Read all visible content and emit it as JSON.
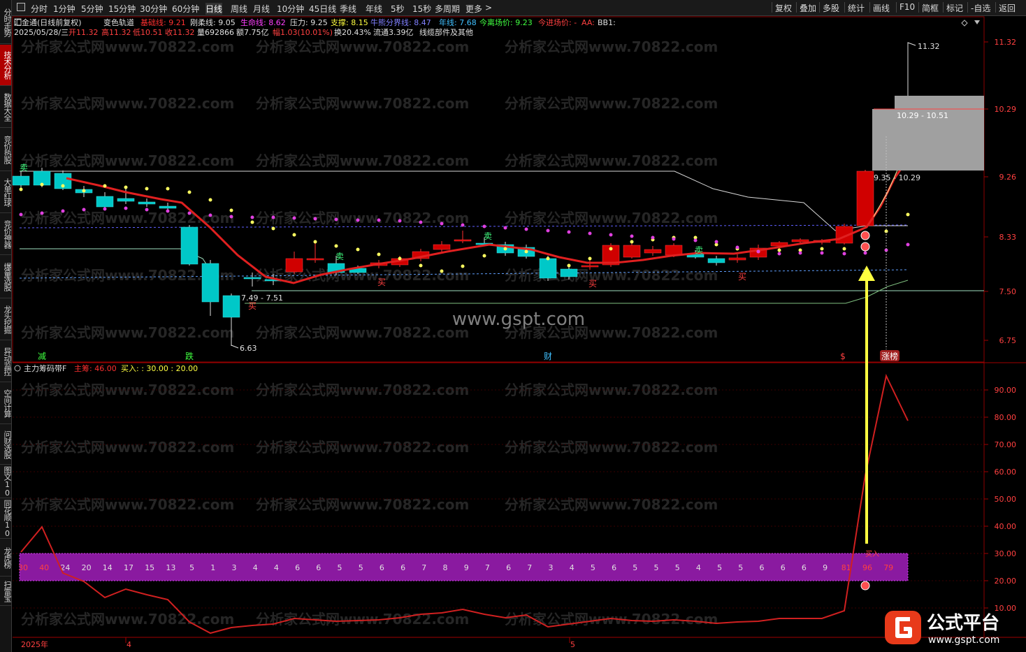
{
  "toolbar": {
    "periods": [
      "分时",
      "1分钟",
      "5分钟",
      "15分钟",
      "30分钟",
      "60分钟",
      "日线",
      "周线",
      "月线",
      "10分钟",
      "45日线",
      "季线",
      "年线",
      "5秒",
      "15秒",
      "多周期",
      "更多"
    ],
    "more_arrow": ">",
    "tools": [
      "复权",
      "叠加",
      "多股",
      "统计",
      "画线",
      "F10",
      "简框",
      "标记",
      "-自选",
      "返回"
    ]
  },
  "sidebar": [
    "分时走势",
    "技术分析",
    "数据大全",
    "竞价热股",
    "大单红球",
    "竞价神器",
    "爆量选股",
    "龙头挖掘",
    "异动监控",
    "空间计算",
    "问财选股",
    "图文10",
    "同花顺10",
    "龙虎榜",
    "扫雷宝"
  ],
  "header": {
    "stock": "汇金通(日线前复权)",
    "indicator": "变色轨道",
    "line1": [
      {
        "t": "基础线: 9.21",
        "c": "#ff3030"
      },
      {
        "t": "刚柔线: 9.05",
        "c": "#e0e0e0"
      },
      {
        "t": "生命线: 8.62",
        "c": "#ff40ff"
      },
      {
        "t": "压力: 9.25",
        "c": "#e0e0e0"
      },
      {
        "t": "支撑: 8.15",
        "c": "#ffff40"
      },
      {
        "t": "牛熊分界线: 8.47",
        "c": "#8080ff"
      },
      {
        "t": "年线: 7.68",
        "c": "#40c0ff"
      },
      {
        "t": "今离场价: 9.23",
        "c": "#40ff40"
      },
      {
        "t": "今进场价: -",
        "c": "#ff4040"
      },
      {
        "t": "AA:",
        "c": "#ff4040"
      },
      {
        "t": "BB1:",
        "c": "#e0e0e0"
      }
    ],
    "line2": [
      {
        "t": "2025/05/28/三",
        "c": "#e0e0e0"
      },
      {
        "t": "开11.32",
        "c": "#ff4040"
      },
      {
        "t": "高11.32",
        "c": "#ff4040"
      },
      {
        "t": "低10.51",
        "c": "#ff4040"
      },
      {
        "t": "收11.32",
        "c": "#ff4040"
      },
      {
        "t": "量692866",
        "c": "#e0e0e0"
      },
      {
        "t": "额7.75亿",
        "c": "#e0e0e0"
      },
      {
        "t": "幅1.03(10.01%)",
        "c": "#ff4040"
      },
      {
        "t": "换20.43%",
        "c": "#e0e0e0"
      },
      {
        "t": "流通3.39亿",
        "c": "#e0e0e0"
      },
      {
        "t": "线缆部件及其他",
        "c": "#e0e0e0"
      }
    ]
  },
  "sub_header": {
    "name": "主力筹码带F",
    "items": [
      {
        "t": "主筹: 46.00",
        "c": "#ff3030"
      },
      {
        "t": "买入: : 30.00 : 20.00",
        "c": "#ffff40"
      }
    ]
  },
  "price_axis": [
    "11.32",
    "10.29",
    "9.26",
    "8.33",
    "7.50",
    "6.75"
  ],
  "sub_axis": [
    "90.00",
    "80.00",
    "70.00",
    "60.00",
    "50.00",
    "40.00",
    "30.00",
    "20.00",
    "10.00"
  ],
  "date_axis": [
    "2025年",
    "4",
    "5"
  ],
  "annotations": {
    "high_label": "11.32",
    "low_label": "6.63",
    "zone1": "7.49 - 7.51",
    "zone2": "9.35 - 10.29",
    "zone3": "10.29 - 10.51",
    "watermark_main": "www.gspt.com",
    "watermark_repeat": "分析家公式网www.70822.com",
    "bottom_marks": [
      "减",
      "跌",
      "财",
      "$",
      "涨榜"
    ],
    "buy_label": "买",
    "sell_label": "卖",
    "buy_sub": "买入"
  },
  "band_values": [
    "30",
    "40",
    "24",
    "20",
    "14",
    "17",
    "15",
    "13",
    "5",
    "1",
    "3",
    "4",
    "4",
    "6",
    "6",
    "5",
    "5",
    "6",
    "6",
    "7",
    "8",
    "9",
    "7",
    "6",
    "7",
    "3",
    "4",
    "5",
    "6",
    "5",
    "5",
    "5",
    "4",
    "5",
    "5",
    "6",
    "6",
    "6",
    "9",
    "81",
    "96",
    "79"
  ],
  "colors": {
    "up": "#d00000",
    "down": "#00c8c8",
    "band": "#8a1aa0",
    "accent": "#ff3030"
  },
  "logo": {
    "text": "公式平台",
    "url_text": "www.gspt.com"
  }
}
